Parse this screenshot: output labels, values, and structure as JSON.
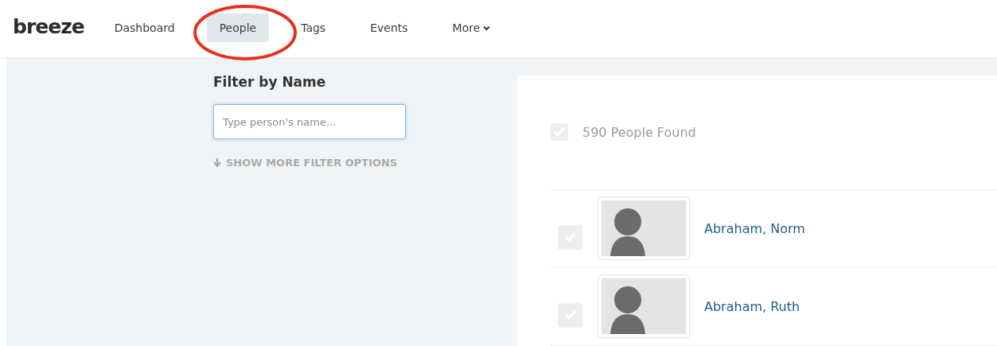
{
  "header": {
    "logo": "breeze",
    "nav": [
      {
        "label": "Dashboard",
        "selected": false,
        "kind": "link"
      },
      {
        "label": "People",
        "selected": true,
        "kind": "link"
      },
      {
        "label": "Tags",
        "selected": false,
        "kind": "link"
      },
      {
        "label": "Events",
        "selected": false,
        "kind": "link"
      },
      {
        "label": "More",
        "selected": false,
        "kind": "dropdown"
      }
    ]
  },
  "filter": {
    "title": "Filter by Name",
    "placeholder": "Type person's name...",
    "more_options": "SHOW MORE FILTER OPTIONS"
  },
  "results": {
    "select_all_checked": false,
    "count": "590 People Found",
    "people": [
      {
        "name": "Abraham, Norm",
        "checked": false
      },
      {
        "name": "Abraham, Ruth",
        "checked": false
      }
    ]
  }
}
